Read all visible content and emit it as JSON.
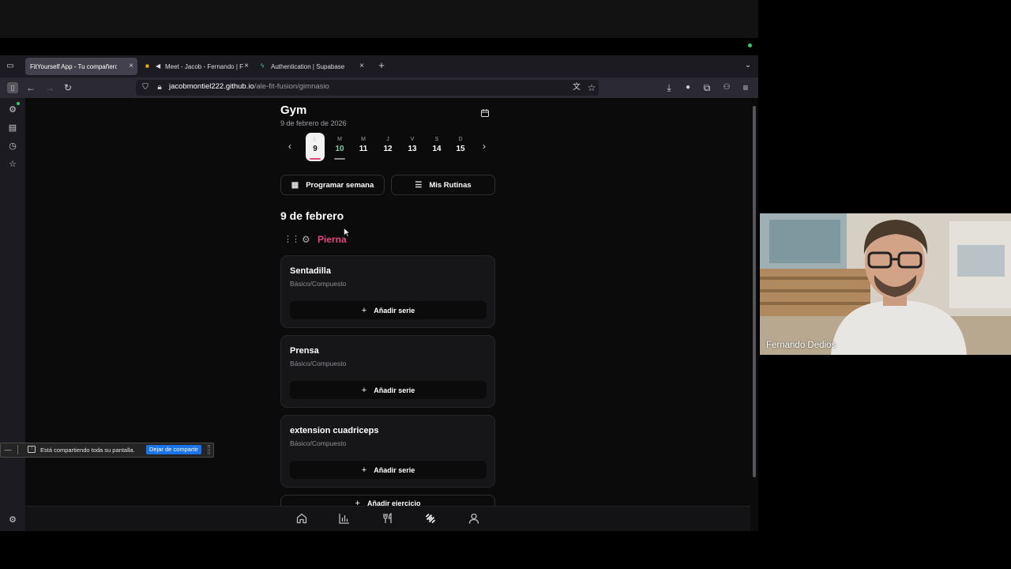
{
  "browser": {
    "tabs": [
      {
        "label": "FitYourself App - Tu compañero de",
        "favicon": "app-icon",
        "active": true
      },
      {
        "label": "Meet - Jacob - Fernando | F",
        "favicon": "meet-icon",
        "active": false
      },
      {
        "label": "Authentication | Supabase",
        "favicon": "supabase-icon",
        "active": false
      }
    ],
    "url_host": "jacobmontiel222.github.io",
    "url_path": "/ale-fit-fusion/gimnasio"
  },
  "page": {
    "title": "Gym",
    "date": "9 de febrero de 2026",
    "week": [
      {
        "letter": "L",
        "day": "9",
        "selected": true,
        "bar": "#e0457b"
      },
      {
        "letter": "M",
        "day": "10",
        "selected": false,
        "today": true,
        "bar": "#8a8a8a"
      },
      {
        "letter": "M",
        "day": "11",
        "selected": false
      },
      {
        "letter": "J",
        "day": "12",
        "selected": false
      },
      {
        "letter": "V",
        "day": "13",
        "selected": false
      },
      {
        "letter": "S",
        "day": "14",
        "selected": false
      },
      {
        "letter": "D",
        "day": "15",
        "selected": false
      }
    ],
    "actions": {
      "schedule_week": "Programar semana",
      "my_routines": "Mis Rutinas"
    },
    "day_heading": "9 de febrero",
    "routine_name": "Pierna",
    "exercises": [
      {
        "name": "Sentadilla",
        "type": "Básico/Compuesto",
        "add_set": "Añadir serie"
      },
      {
        "name": "Prensa",
        "type": "Básico/Compuesto",
        "add_set": "Añadir serie"
      },
      {
        "name": "extension cuadriceps",
        "type": "Básico/Compuesto",
        "add_set": "Añadir serie"
      }
    ],
    "add_exercise": "Añadir ejercicio",
    "bottom_nav": [
      "home-icon",
      "stats-icon",
      "food-icon",
      "gym-icon",
      "profile-icon"
    ]
  },
  "share_banner": {
    "text": "Está compartiendo toda su pantalla.",
    "stop": "Dejar de compartir"
  },
  "video": {
    "participant": "Fernando Dedios"
  },
  "colors": {
    "accent": "#e0457b",
    "today_number": "#7dcea0",
    "share_button": "#1a73e8"
  }
}
